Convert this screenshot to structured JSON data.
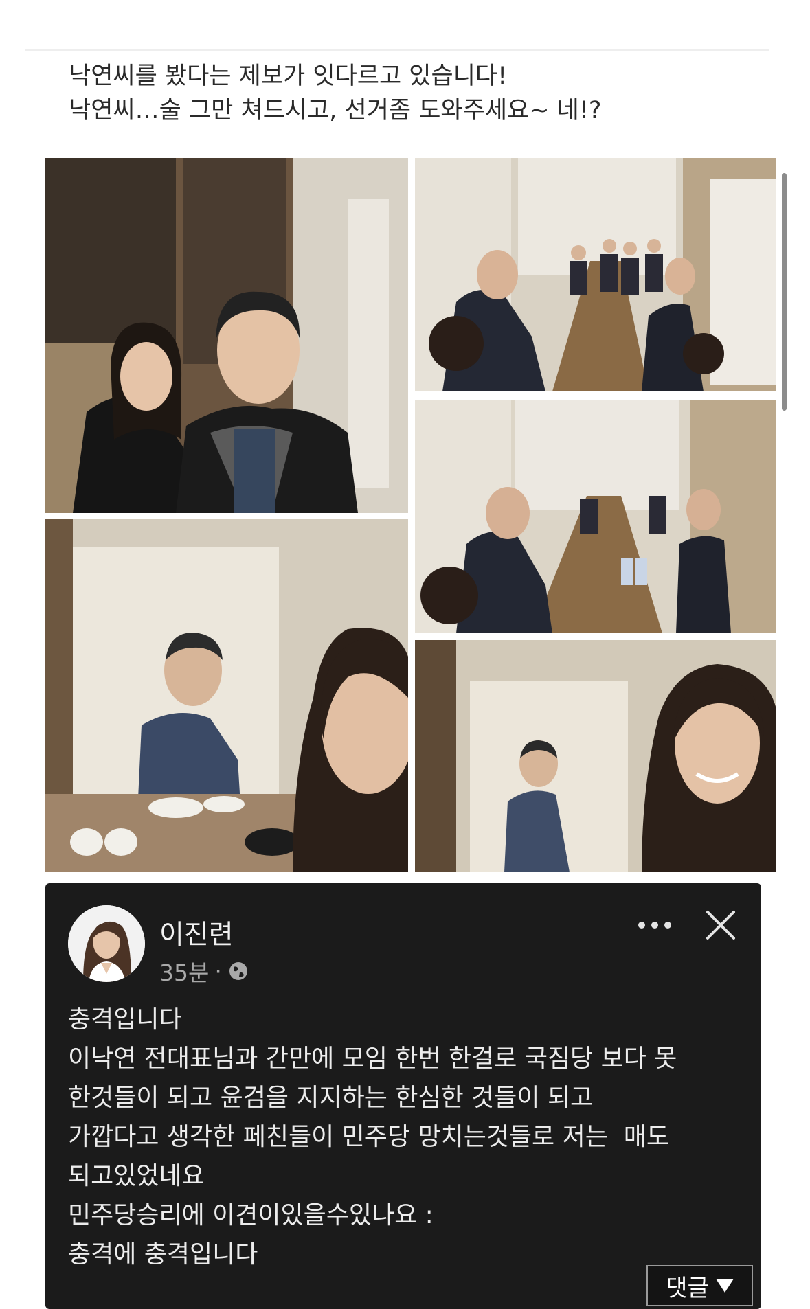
{
  "caption": {
    "line1": "낙연씨를 봤다는 제보가 잇다르고 있습니다!",
    "line2": "낙연씨…술 그만 쳐드시고, 선거좀 도와주세요~ 네!?"
  },
  "post": {
    "author": "이진련",
    "time": "35분",
    "separator": "·",
    "lines": [
      "충격입니다",
      "이낙연 전대표님과 간만에 모임 한번 한걸로 국짐당 보다 못",
      "한것들이 되고 윤검을 지지하는 한심한 것들이 되고",
      "가깝다고 생각한 페친들이 민주당 망치는것들로 저는  매도",
      "되고있었네요",
      "민주당승리에 이견이있을수있나요 :",
      "충격에 충격입니다"
    ],
    "comment_button": "댓글"
  },
  "icons": {
    "more": "more-horizontal-icon",
    "close": "close-icon",
    "globe": "globe-icon",
    "dropdown": "caret-down-icon"
  },
  "colors": {
    "card_bg": "#1b1b1b",
    "card_text": "#ececec",
    "meta_text": "#a9a9a9"
  }
}
